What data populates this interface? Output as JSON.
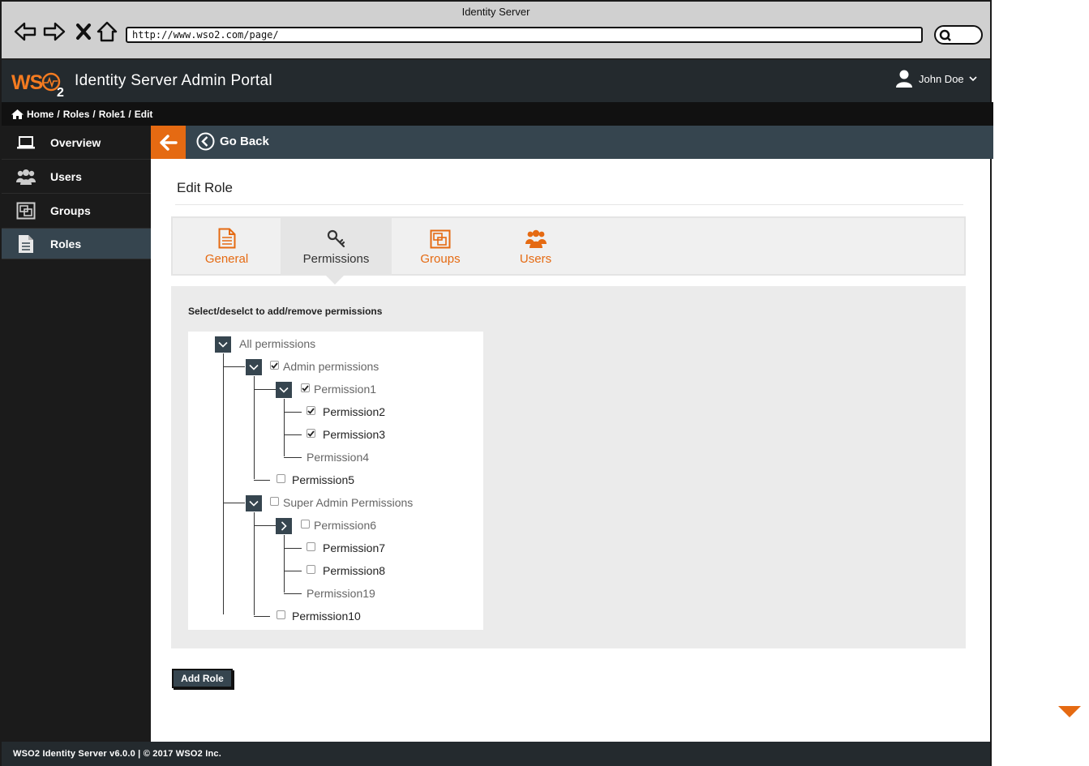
{
  "browser": {
    "title": "Identity Server",
    "url": "http://www.wso2.com/page/"
  },
  "header": {
    "logo": "WSO2",
    "title": "Identity Server Admin Portal",
    "user_name": "John Doe"
  },
  "breadcrumb": [
    "Home",
    "Roles",
    "Role1",
    "Edit"
  ],
  "sidebar": {
    "items": [
      {
        "label": "Overview",
        "icon": "laptop-icon"
      },
      {
        "label": "Users",
        "icon": "users-icon"
      },
      {
        "label": "Groups",
        "icon": "groups-icon"
      },
      {
        "label": "Roles",
        "icon": "document-icon",
        "active": true
      }
    ]
  },
  "go_back_label": "Go Back",
  "page_title": "Edit Role",
  "tabs": [
    {
      "label": "General",
      "icon": "document-icon"
    },
    {
      "label": "Permissions",
      "icon": "key-icon",
      "active": true
    },
    {
      "label": "Groups",
      "icon": "groups-icon"
    },
    {
      "label": "Users",
      "icon": "users-icon"
    }
  ],
  "permissions": {
    "hint": "Select/deselct to add/remove permissions",
    "tree": {
      "root": "All permissions",
      "admin": "Admin permissions",
      "permission1": "Permission1",
      "permission2": "Permission2",
      "permission3": "Permission3",
      "permission4": "Permission4",
      "permission5": "Permission5",
      "super_admin": "Super Admin Permissions",
      "permission6": "Permission6",
      "permission7": "Permission7",
      "permission8": "Permission8",
      "permission19": "Permission19",
      "permission10": "Permission10"
    },
    "checked": {
      "admin": true,
      "permission1": true,
      "permission2": true,
      "permission3": true,
      "permission5": false,
      "super_admin": false,
      "permission6": false,
      "permission7": false,
      "permission8": false,
      "permission10": false
    }
  },
  "add_role_label": "Add Role",
  "footer": "WSO2 Identity Server v6.0.0 | © 2017 WSO2 Inc.",
  "colors": {
    "accent": "#e56a12",
    "header_bg": "#242a2e",
    "sidebar_bg": "#1b1b1b",
    "bar_bg": "#36454f"
  }
}
